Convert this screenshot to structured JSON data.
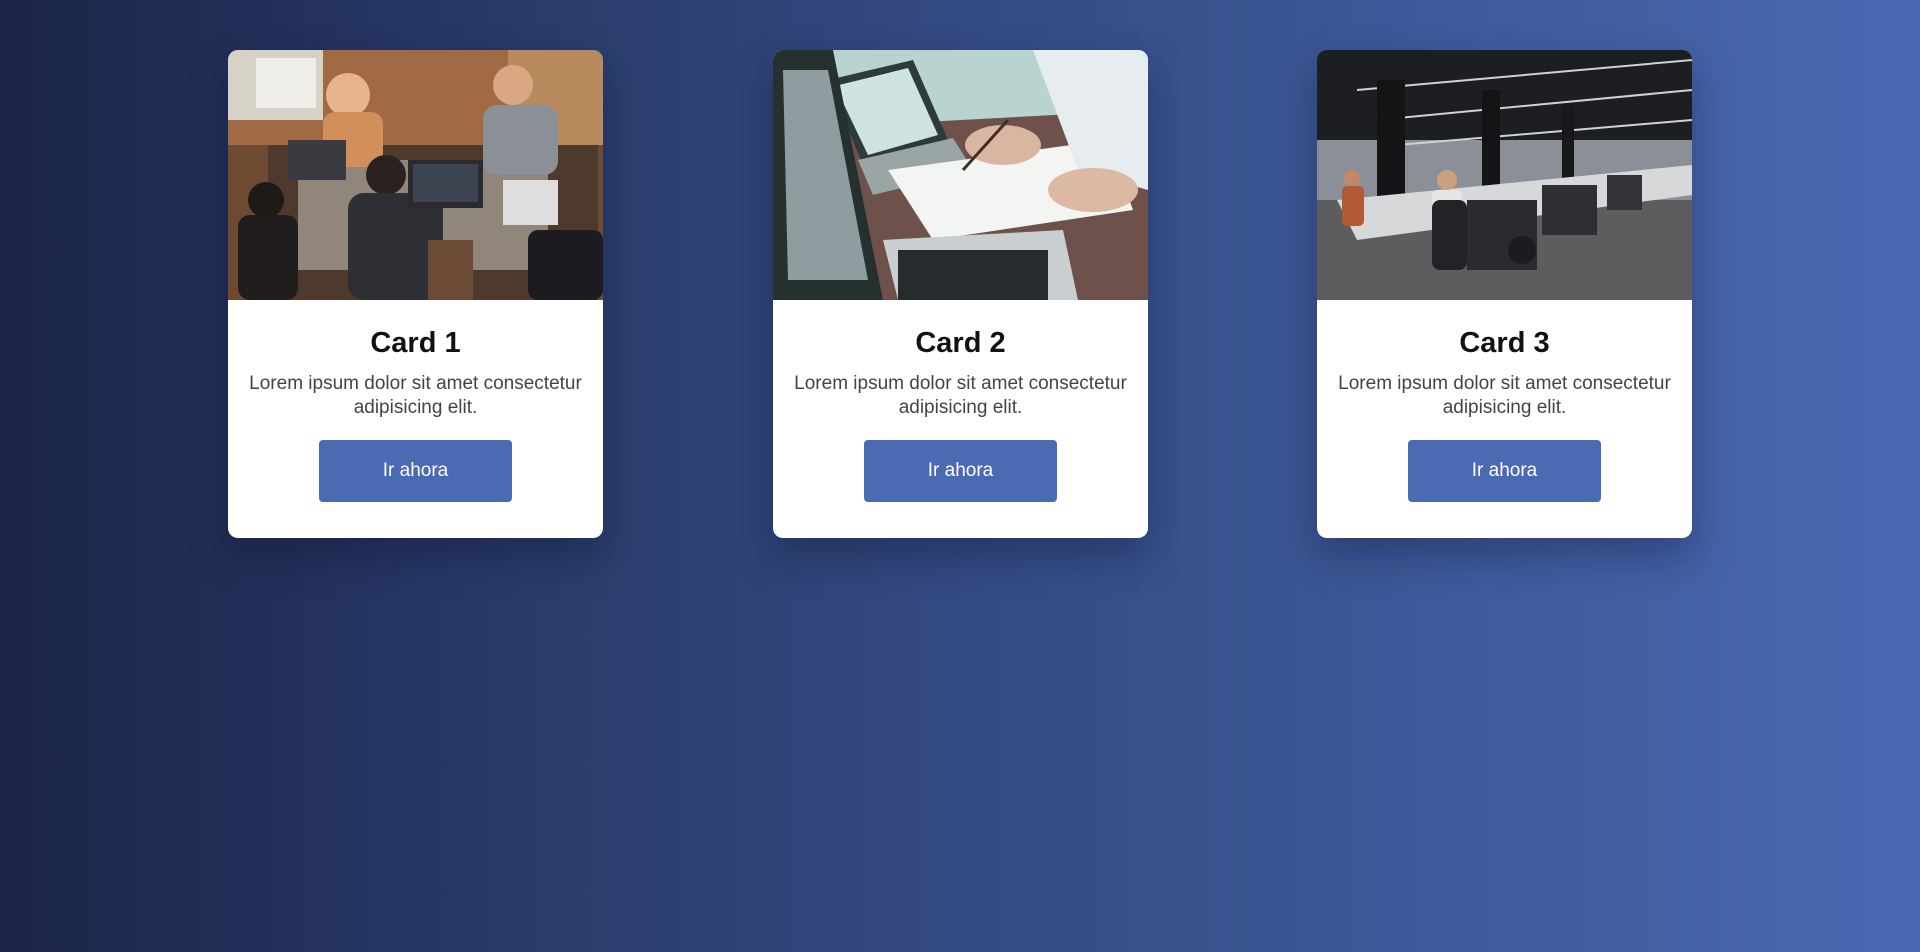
{
  "colors": {
    "background_start": "#1b2548",
    "background_end": "#4a69b3",
    "card_background": "#ffffff",
    "button_background": "#4a6ab4",
    "button_text": "#ffffff"
  },
  "cards": [
    {
      "title": "Card 1",
      "text": "Lorem ipsum dolor sit amet consectetur adipisicing elit.",
      "button_label": "Ir ahora",
      "image": "team-working-on-laptops-photo"
    },
    {
      "title": "Card 2",
      "text": "Lorem ipsum dolor sit amet consectetur adipisicing elit.",
      "button_label": "Ir ahora",
      "image": "laptop-and-paperwork-photo"
    },
    {
      "title": "Card 3",
      "text": "Lorem ipsum dolor sit amet consectetur adipisicing elit.",
      "button_label": "Ir ahora",
      "image": "open-plan-office-photo"
    }
  ]
}
